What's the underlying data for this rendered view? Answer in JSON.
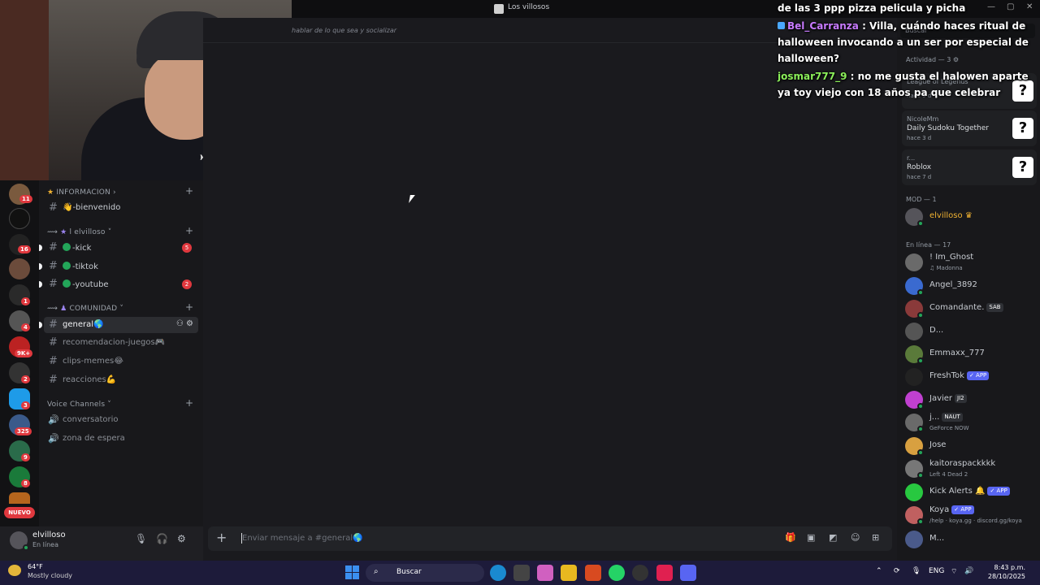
{
  "window": {
    "title": "Los villosos",
    "controls": [
      "—",
      "▢",
      "✕"
    ]
  },
  "overlay_chat": [
    {
      "user": "",
      "text": "de las 3 ppp pizza pelicula y picha"
    },
    {
      "user": "Bel_Carranza",
      "text": ": Villa, cuándo haces ritual de halloween invocando a un ser por especial de halloween?"
    },
    {
      "user": "josmar777_9",
      "text": ": no me gusta el halowen aparte ya toy viejo con 18 años pa que celebrar"
    }
  ],
  "servers": {
    "badges": [
      "11",
      "16",
      "1",
      "4",
      "9K+",
      "2",
      "3",
      "325",
      "9",
      "8"
    ],
    "nuevo_label": "NUEVO"
  },
  "channels": {
    "categories": {
      "informacion": "INFORMACION",
      "elvillloso": "l elvilloso",
      "comunidad": "COMUNIDAD",
      "voice": "Voice Channels"
    },
    "bienvenido": "-bienvenido",
    "kick": "-kick",
    "kick_badge": "5",
    "tiktok": "-tiktok",
    "youtube": "-youtube",
    "youtube_badge": "2",
    "general": "general",
    "recomendacion": "recomendacion-juegos",
    "clips": "clips-memes",
    "reacciones": "reacciones",
    "conversatorio": "conversatorio",
    "zona": "zona de espera"
  },
  "user_panel": {
    "name": "elvilloso",
    "status": "En línea"
  },
  "main": {
    "topic": "hablar de lo que sea y socializar",
    "composer_placeholder": "Enviar mensaje a #general"
  },
  "members": {
    "search_placeholder": "Buscar",
    "activity_header": "Actividad — 3",
    "activities": [
      {
        "user": "League of Legends",
        "game": "",
        "time": "hace 9 d"
      },
      {
        "user": "NicoleMm",
        "game": "Daily Sudoku Together",
        "time": "hace 3 d"
      },
      {
        "user": "r...",
        "game": "Roblox",
        "time": "hace 7 d"
      }
    ],
    "mod_header": "MOD — 1",
    "mod": "elvilloso",
    "online_header": "En línea — 17",
    "online": [
      {
        "name": "! Im_Ghost",
        "sub": "♫ Madonna"
      },
      {
        "name": "Angel_3892",
        "sub": ""
      },
      {
        "name": "Comandante.",
        "sub": "",
        "tag": "SAB"
      },
      {
        "name": "D...",
        "sub": ""
      },
      {
        "name": "Emmaxx_777",
        "sub": ""
      },
      {
        "name": "FreshTok",
        "sub": "",
        "tag": "✓ APP"
      },
      {
        "name": "Javier",
        "sub": "",
        "tag": "JI2"
      },
      {
        "name": "j...",
        "sub": "GeForce NOW",
        "tag": "NAUT"
      },
      {
        "name": "Jose",
        "sub": ""
      },
      {
        "name": "kaitoraspackkkk",
        "sub": "Left 4 Dead 2"
      },
      {
        "name": "Kick Alerts",
        "sub": "",
        "tag": "✓ APP"
      },
      {
        "name": "Koya",
        "sub": "/help · koya.gg · discord.gg/koya",
        "tag": "✓ APP"
      },
      {
        "name": "M...",
        "sub": ""
      }
    ]
  },
  "taskbar": {
    "temp": "64°F",
    "weather": "Mostly cloudy",
    "search": "Buscar",
    "lang": "ENG",
    "time": "8:43 p.m.",
    "date": "28/10/2025"
  },
  "colors": {
    "accent": "#5865f2",
    "online": "#23a559",
    "badge": "#e0383e"
  }
}
